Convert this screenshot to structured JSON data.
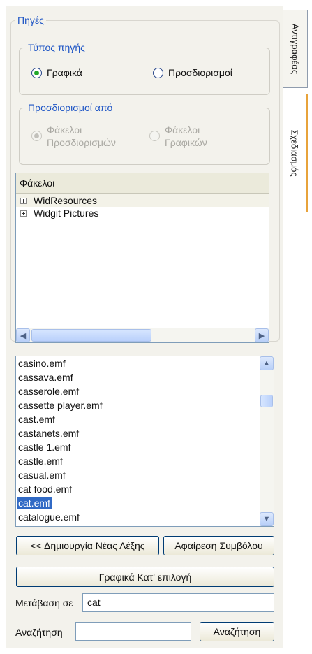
{
  "tabs": [
    {
      "label": "Αντιγραφέας"
    },
    {
      "label": "Σχεδιασμός"
    }
  ],
  "sources": {
    "title": "Πηγές",
    "source_type": {
      "title": "Τύπος πηγής",
      "options": [
        {
          "label": "Γραφικά",
          "checked": true
        },
        {
          "label": "Προσδιορισμοί",
          "checked": false
        }
      ]
    },
    "qualifiers_from": {
      "title": "Προσδιορισμοί από",
      "options": [
        {
          "label": "Φάκελοι Προσδιορισμών",
          "checked": true,
          "enabled": false
        },
        {
          "label": "Φάκελοι Γραφικών",
          "checked": false,
          "enabled": false
        }
      ]
    }
  },
  "folders": {
    "header": "Φάκελοι",
    "items": [
      {
        "label": "WidResources"
      },
      {
        "label": "Widgit Pictures"
      }
    ]
  },
  "files": {
    "items": [
      "casino.emf",
      "cassava.emf",
      "casserole.emf",
      "cassette player.emf",
      "cast.emf",
      "castanets.emf",
      "castle 1.emf",
      "castle.emf",
      "casual.emf",
      "cat food.emf",
      "cat.emf",
      "catalogue.emf"
    ],
    "selected": "cat.emf"
  },
  "buttons": {
    "create_word": "<< Δημιουργία Νέας Λέξης",
    "remove_symbol": "Αφαίρεση Συμβόλου",
    "graphics_selection": "Γραφικά Κατ' επιλογή",
    "search": "Αναζήτηση"
  },
  "goto": {
    "label": "Μετάβαση σε",
    "value": "cat"
  },
  "search": {
    "label": "Αναζήτηση",
    "value": ""
  },
  "colors": {
    "accent": "#1e55c5",
    "selection": "#316ac5",
    "active_tab_marker": "#e8a33b"
  }
}
